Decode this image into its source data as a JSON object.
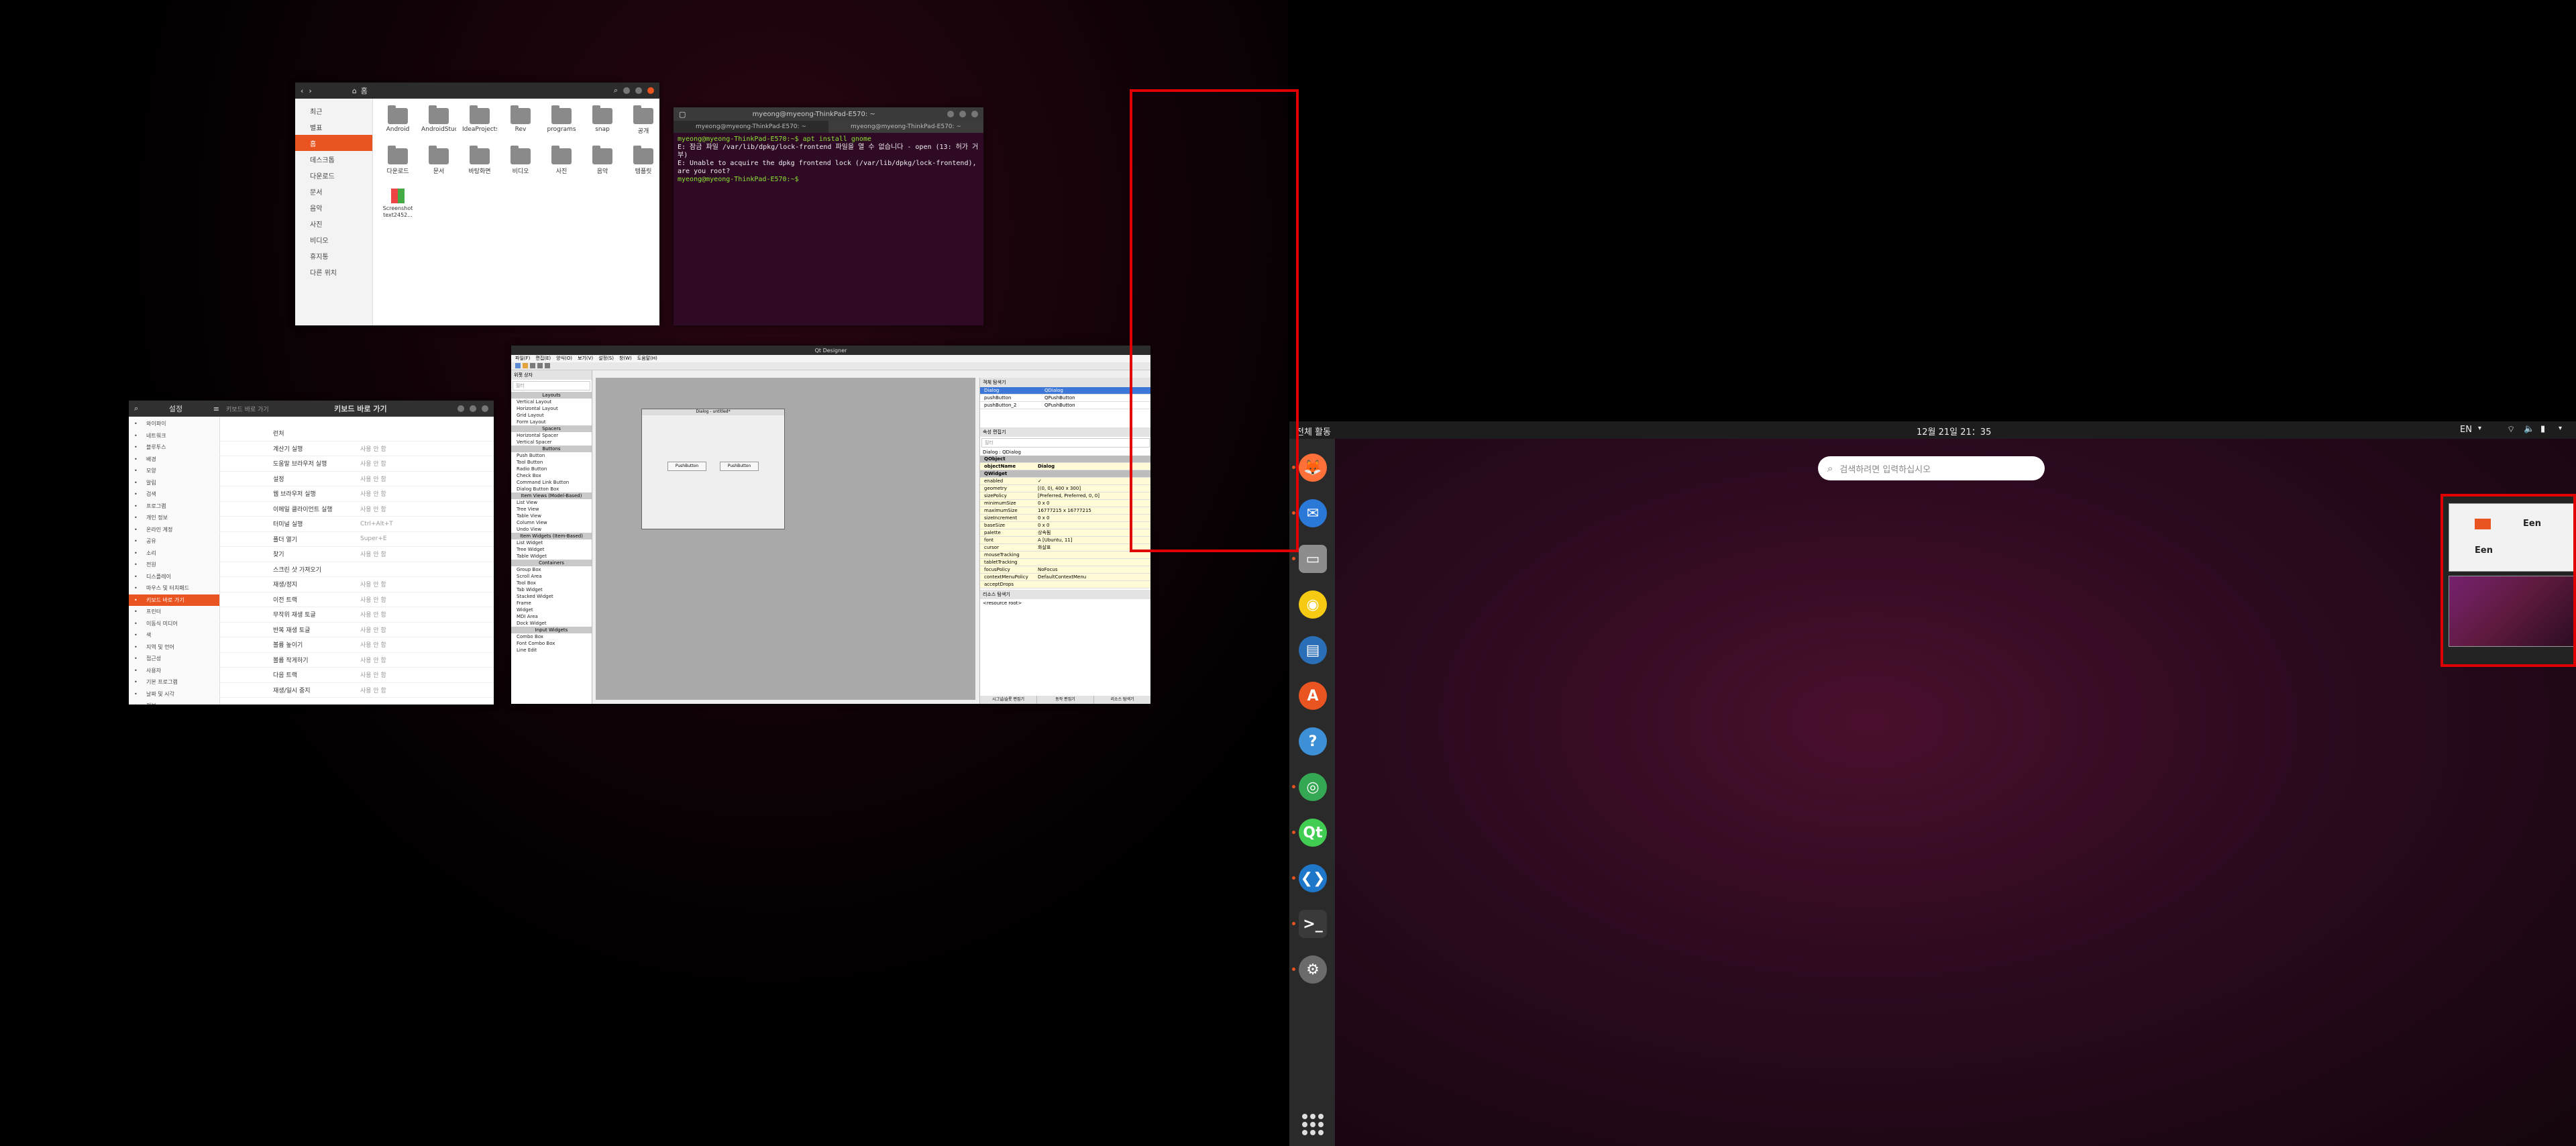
{
  "desktop": {
    "files": {
      "path": "홈",
      "sidebar": [
        "최근",
        "별표",
        "홈",
        "데스크톱",
        "다운로드",
        "문서",
        "음악",
        "사진",
        "비디오",
        "휴지통",
        "다른 위치"
      ],
      "active_index": 2,
      "folders": [
        "Android",
        "AndroidStudioProjects",
        "IdeaProjects",
        "Rev",
        "programs",
        "snap",
        "공개",
        "다운로드",
        "문서",
        "바탕화면",
        "비디오",
        "사진",
        "음악",
        "템플릿"
      ],
      "extra_file_label": "Screenshot from 2021-...",
      "extra_file_name": "text2452..."
    },
    "terminal": {
      "tab1": "myeong@myeong-ThinkPad-E570: ~",
      "tab2": "myeong@myeong-ThinkPad-E570: ~",
      "lines": [
        "myeong@myeong-ThinkPad-E570:~$ apt install gnome",
        "E: 잠금 파일 /var/lib/dpkg/lock-frontend 파일을 열 수 없습니다 - open (13: 허가 거부)",
        "E: Unable to acquire the dpkg frontend lock (/var/lib/dpkg/lock-frontend), are you root?",
        "myeong@myeong-ThinkPad-E570:~$ "
      ]
    },
    "settings": {
      "title": "설정",
      "search_placeholder": "키보드 바로 가기",
      "panel_title": "키보드 바로 가기",
      "sidebar": [
        "와이파이",
        "네트워크",
        "블루투스",
        "배경",
        "모양",
        "알림",
        "검색",
        "프로그램",
        "개인 정보",
        "온라인 계정",
        "공유",
        "소리",
        "전원",
        "디스플레이",
        "마우스 및 터치패드",
        "키보드 바로 가기",
        "프린터",
        "이동식 미디어",
        "색",
        "지역 및 언어",
        "접근성",
        "사용자",
        "기본 프로그램",
        "날짜 및 시각",
        "정보"
      ],
      "active_index": 15,
      "rows": [
        {
          "label": "런처",
          "acc": ""
        },
        {
          "label": "계산기 실행",
          "acc": "사용 안 함"
        },
        {
          "label": "도움말 브라우저 실행",
          "acc": "사용 안 함"
        },
        {
          "label": "설정",
          "acc": "사용 안 함"
        },
        {
          "label": "웹 브라우저 실행",
          "acc": "사용 안 함"
        },
        {
          "label": "이메일 클라이언트 실행",
          "acc": "사용 안 함"
        },
        {
          "label": "터미널 실행",
          "acc": "Ctrl+Alt+T"
        },
        {
          "label": "폴더 열기",
          "acc": "Super+E"
        },
        {
          "label": "찾기",
          "acc": "사용 안 함"
        },
        {
          "label": "스크린 샷 가져오기",
          "acc": ""
        },
        {
          "label": "재생/정지",
          "acc": "사용 안 함"
        },
        {
          "label": "이전 트랙",
          "acc": "사용 안 함"
        },
        {
          "label": "무작위 재생 토글",
          "acc": "사용 안 함"
        },
        {
          "label": "반복 재생 토글",
          "acc": "사용 안 함"
        },
        {
          "label": "볼륨 높이기",
          "acc": "사용 안 함"
        },
        {
          "label": "볼륨 작게하기",
          "acc": "사용 안 함"
        },
        {
          "label": "다음 트랙",
          "acc": "사용 안 함"
        },
        {
          "label": "재생/일시 중지",
          "acc": "사용 안 함"
        }
      ]
    },
    "qt": {
      "title": "Qt Designer",
      "menu": [
        "파일(F)",
        "편집(E)",
        "양식(O)",
        "보기(V)",
        "설정(S)",
        "창(W)",
        "도움말(H)"
      ],
      "widget_box_title": "위젯 상자",
      "filter_placeholder": "필터",
      "widgets": [
        {
          "name": "Layouts",
          "cat": true
        },
        {
          "name": "Vertical Layout"
        },
        {
          "name": "Horizontal Layout"
        },
        {
          "name": "Grid Layout"
        },
        {
          "name": "Form Layout"
        },
        {
          "name": "Spacers",
          "cat": true
        },
        {
          "name": "Horizontal Spacer"
        },
        {
          "name": "Vertical Spacer"
        },
        {
          "name": "Buttons",
          "cat": true
        },
        {
          "name": "Push Button"
        },
        {
          "name": "Tool Button"
        },
        {
          "name": "Radio Button"
        },
        {
          "name": "Check Box"
        },
        {
          "name": "Command Link Button"
        },
        {
          "name": "Dialog Button Box"
        },
        {
          "name": "Item Views (Model-Based)",
          "cat": true
        },
        {
          "name": "List View"
        },
        {
          "name": "Tree View"
        },
        {
          "name": "Table View"
        },
        {
          "name": "Column View"
        },
        {
          "name": "Undo View"
        },
        {
          "name": "Item Widgets (Item-Based)",
          "cat": true
        },
        {
          "name": "List Widget"
        },
        {
          "name": "Tree Widget"
        },
        {
          "name": "Table Widget"
        },
        {
          "name": "Containers",
          "cat": true
        },
        {
          "name": "Group Box"
        },
        {
          "name": "Scroll Area"
        },
        {
          "name": "Tool Box"
        },
        {
          "name": "Tab Widget"
        },
        {
          "name": "Stacked Widget"
        },
        {
          "name": "Frame"
        },
        {
          "name": "Widget"
        },
        {
          "name": "MDI Area"
        },
        {
          "name": "Dock Widget"
        },
        {
          "name": "Input Widgets",
          "cat": true
        },
        {
          "name": "Combo Box"
        },
        {
          "name": "Font Combo Box"
        },
        {
          "name": "Line Edit"
        }
      ],
      "dialog_title": "Dialog - untitled*",
      "dialog_buttons": [
        "PushButton",
        "PushButton"
      ],
      "object_inspector": "객체 탐색기",
      "object_rows": [
        {
          "obj": "Dialog",
          "cls": "QDialog"
        },
        {
          "obj": "pushButton",
          "cls": "QPushButton"
        },
        {
          "obj": "pushButton_2",
          "cls": "QPushButton"
        }
      ],
      "property_editor": "속성 편집기",
      "prop_filter": "필터",
      "prop_context": "Dialog : QDialog",
      "properties": [
        {
          "k": "QObject",
          "v": "",
          "cat": true
        },
        {
          "k": "objectName",
          "v": "Dialog",
          "bold": true
        },
        {
          "k": "QWidget",
          "v": "",
          "cat": true
        },
        {
          "k": "enabled",
          "v": "✓"
        },
        {
          "k": "geometry",
          "v": "[(0, 0), 400 x 300]"
        },
        {
          "k": "sizePolicy",
          "v": "[Preferred, Preferred, 0, 0]"
        },
        {
          "k": "minimumSize",
          "v": "0 x 0"
        },
        {
          "k": "maximumSize",
          "v": "16777215 x 16777215"
        },
        {
          "k": "sizeIncrement",
          "v": "0 x 0"
        },
        {
          "k": "baseSize",
          "v": "0 x 0"
        },
        {
          "k": "palette",
          "v": "상속됨"
        },
        {
          "k": "font",
          "v": "A [Ubuntu, 11]"
        },
        {
          "k": "cursor",
          "v": "화살표"
        },
        {
          "k": "mouseTracking",
          "v": ""
        },
        {
          "k": "tabletTracking",
          "v": ""
        },
        {
          "k": "focusPolicy",
          "v": "NoFocus"
        },
        {
          "k": "contextMenuPolicy",
          "v": "DefaultContextMenu"
        },
        {
          "k": "acceptDrops",
          "v": ""
        }
      ],
      "resource_browser": "리소스 탐색기",
      "resource_root": "<resource root>",
      "bottom_tabs": [
        "시그널/슬롯 편집기",
        "동작 편집기",
        "리소스 탐색기"
      ]
    }
  },
  "overview": {
    "activities": "전체 활동",
    "clock": "12월 21일  21：35",
    "lang": "EN",
    "search_placeholder": "검색하려면 입력하십시오",
    "dock_apps": [
      {
        "name": "firefox-icon",
        "glyph": "🦊",
        "color": "#ff7139"
      },
      {
        "name": "thunderbird-icon",
        "glyph": "✉",
        "color": "#2a78d8"
      },
      {
        "name": "files-icon",
        "glyph": "▭",
        "color": "#8d8d8d"
      },
      {
        "name": "rhythmbox-icon",
        "glyph": "◉",
        "color": "#f6c913"
      },
      {
        "name": "libreoffice-writer-icon",
        "glyph": "▤",
        "color": "#2a6eb8"
      },
      {
        "name": "software-icon",
        "glyph": "A",
        "color": "#e95420"
      },
      {
        "name": "help-icon",
        "glyph": "?",
        "color": "#3d8fd6"
      },
      {
        "name": "chrome-icon",
        "glyph": "◎",
        "color": "#34a853"
      },
      {
        "name": "qt-designer-icon",
        "glyph": "Qt",
        "color": "#41cd52"
      },
      {
        "name": "vscode-icon",
        "glyph": "❮❯",
        "color": "#1f77c9"
      },
      {
        "name": "terminal-icon",
        "glyph": ">_",
        "color": "#3a3a3a"
      },
      {
        "name": "settings-icon",
        "glyph": "⚙",
        "color": "#6b6b6b"
      }
    ],
    "show_apps_icon": "grid-icon",
    "workspace_thumb_text": "Een"
  },
  "colors": {
    "accent": "#e95420",
    "highlight": "#e00000"
  }
}
